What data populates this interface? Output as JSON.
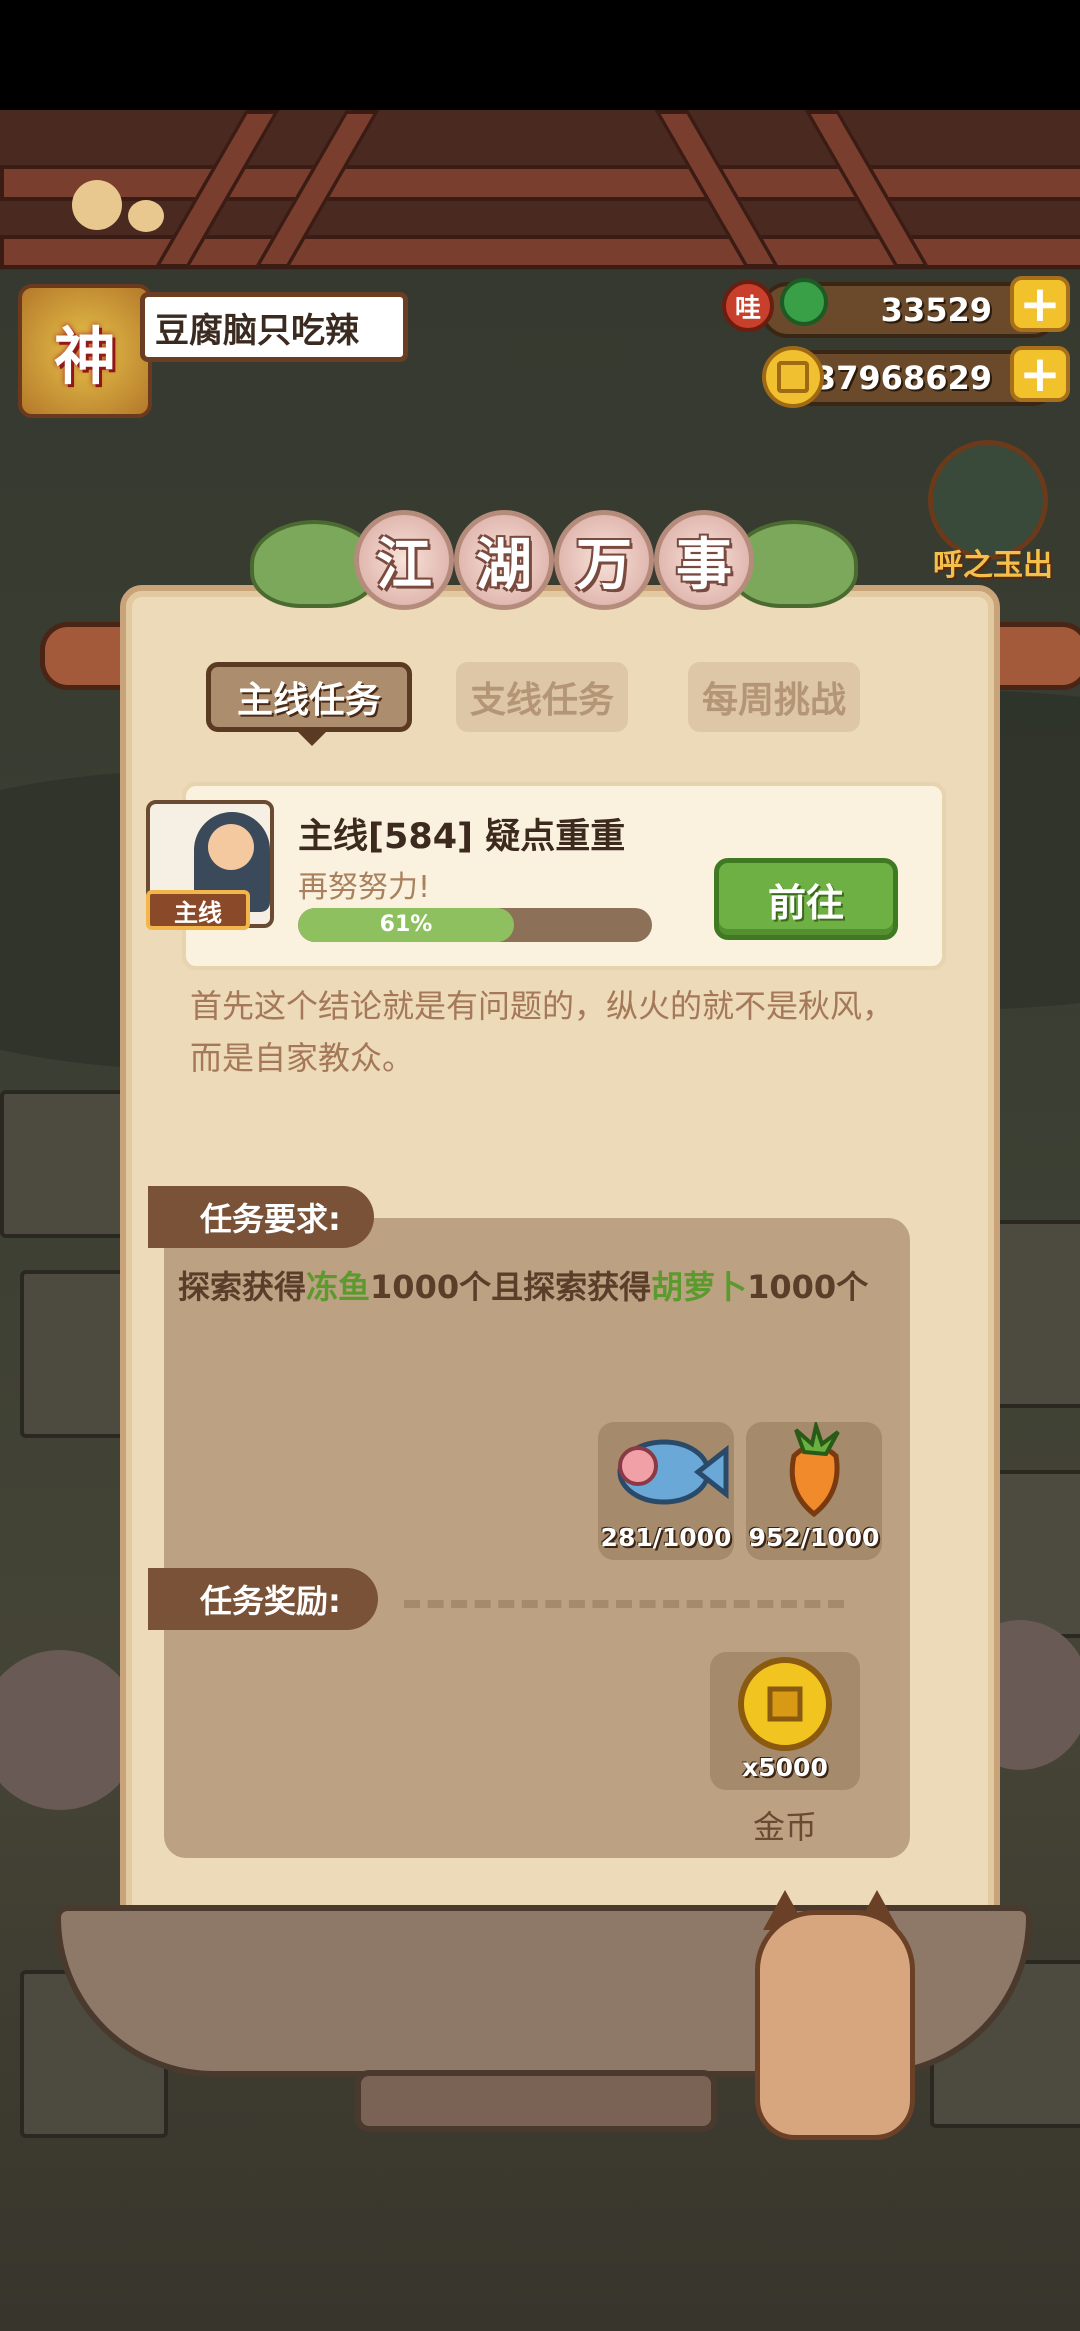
{
  "player": {
    "avatar_char": "神",
    "name": "豆腐脑只吃辣"
  },
  "currency": {
    "gem": {
      "icon_label": "哇",
      "value": "33529"
    },
    "coin": {
      "value": "37968629"
    },
    "plus_symbol": "+"
  },
  "side_event": {
    "label": "呼之玉出"
  },
  "panel": {
    "title_chars": [
      "江",
      "湖",
      "万",
      "事"
    ],
    "tabs": [
      {
        "label": "主线任务",
        "active": true
      },
      {
        "label": "支线任务",
        "active": false
      },
      {
        "label": "每周挑战",
        "active": false
      }
    ]
  },
  "quest": {
    "tag": "主线",
    "title": "主线[584] 疑点重重",
    "subtitle": "再努努力!",
    "progress_percent": 61,
    "progress_text": "61%",
    "go_button": "前往",
    "story": "首先这个结论就是有问题的，纵火的就不是秋风，而是自家教众。"
  },
  "requirements": {
    "header": "任务要求:",
    "text_parts": [
      "探索获得",
      "冻鱼",
      "1000个且探索获得",
      "胡萝卜",
      "1000个"
    ],
    "items": [
      {
        "icon": "frozen-fish-icon",
        "count": "281/1000"
      },
      {
        "icon": "carrot-icon",
        "count": "952/1000"
      }
    ]
  },
  "rewards": {
    "header": "任务奖励:",
    "items": [
      {
        "icon": "gold-coin-icon",
        "count": "x5000",
        "label": "金币"
      }
    ]
  }
}
